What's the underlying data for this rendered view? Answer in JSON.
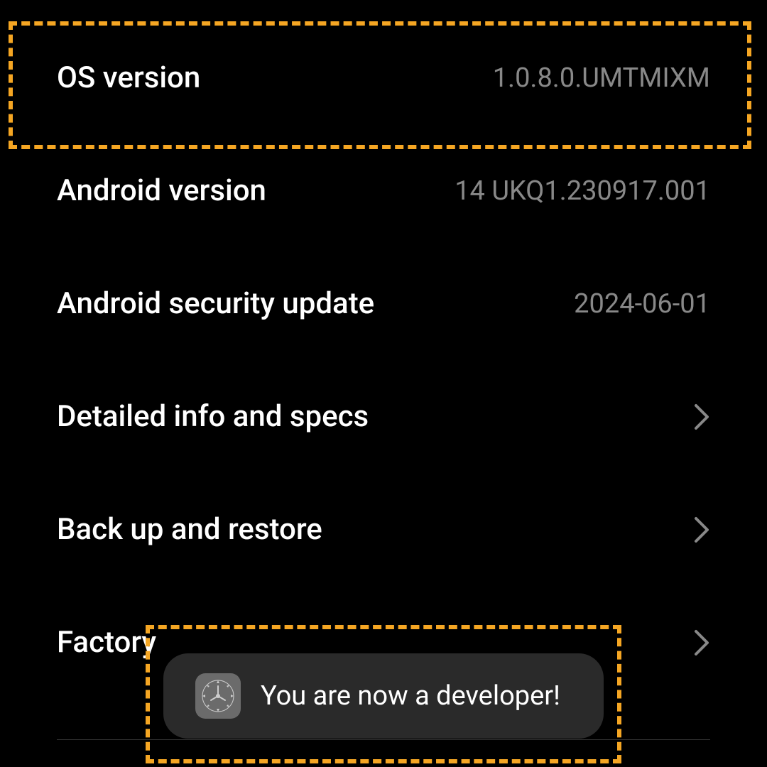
{
  "settings": {
    "os_version": {
      "label": "OS version",
      "value": "1.0.8.0.UMTMIXM"
    },
    "android_version": {
      "label": "Android version",
      "value": "14 UKQ1.230917.001"
    },
    "security_update": {
      "label": "Android security update",
      "value": "2024-06-01"
    },
    "detailed_info": {
      "label": "Detailed info and specs"
    },
    "backup_restore": {
      "label": "Back up and restore"
    },
    "factory_reset": {
      "label": "Factory"
    }
  },
  "toast": {
    "message": "You are now a developer!"
  }
}
